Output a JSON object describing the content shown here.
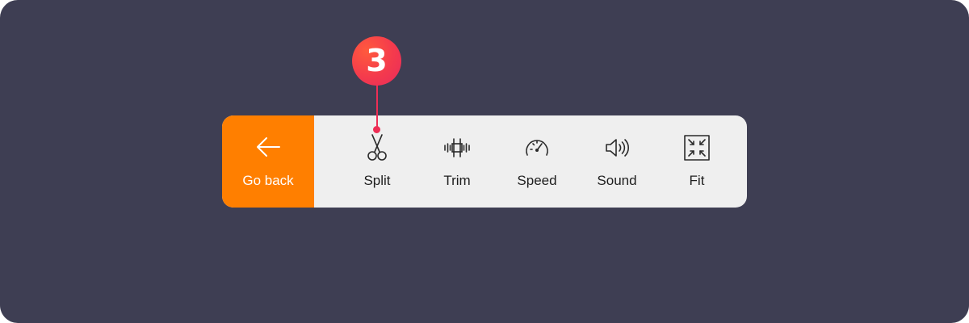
{
  "toolbar": {
    "back": {
      "label": "Go back",
      "icon": "arrow-left-icon"
    },
    "tools": [
      {
        "id": "split",
        "label": "Split",
        "icon": "scissors-icon"
      },
      {
        "id": "trim",
        "label": "Trim",
        "icon": "trim-icon"
      },
      {
        "id": "speed",
        "label": "Speed",
        "icon": "speedometer-icon"
      },
      {
        "id": "sound",
        "label": "Sound",
        "icon": "speaker-icon"
      },
      {
        "id": "fit",
        "label": "Fit",
        "icon": "fit-screen-icon"
      }
    ]
  },
  "callout": {
    "step": "3"
  },
  "colors": {
    "background": "#3e3e53",
    "toolbar": "#efefef",
    "accent": "#ff7f00",
    "badge": "#f43a4d"
  }
}
